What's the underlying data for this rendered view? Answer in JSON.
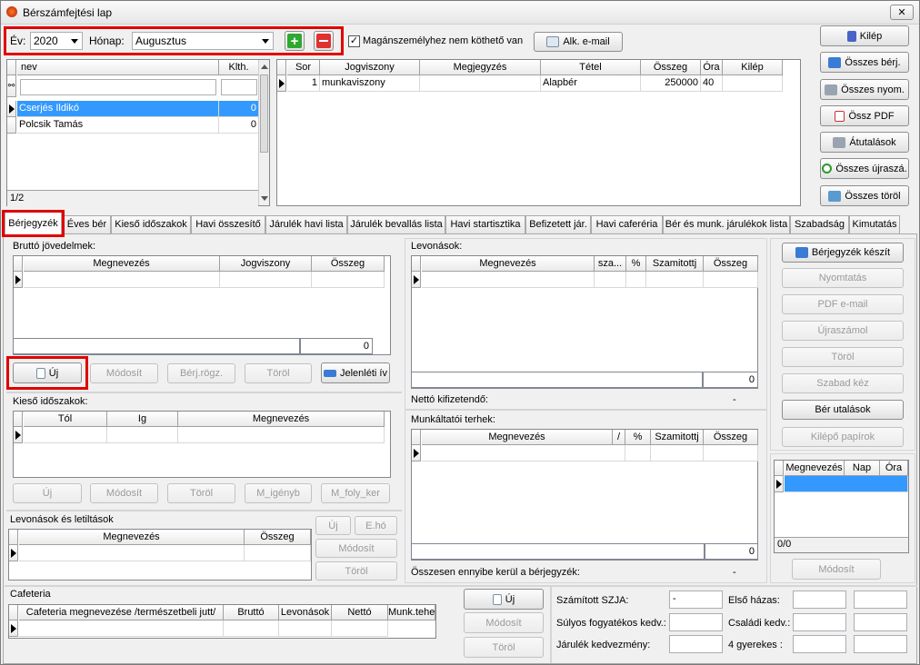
{
  "window": {
    "title": "Bérszámfejtési lap",
    "close": "✕"
  },
  "top": {
    "year_label": "Év:",
    "year_value": "2020",
    "month_label": "Hónap:",
    "month_value": "Augusztus",
    "checkbox_label": "Magánszemélyhez nem köthető van",
    "alk_email": "Alk. e-mail"
  },
  "people": {
    "headers": [
      "nev",
      "Klth."
    ],
    "rows": [
      [
        "Cserjés Ildikó",
        "0"
      ],
      [
        "Polcsik Tamás",
        "0"
      ]
    ],
    "counter": "1/2"
  },
  "jobs": {
    "headers": [
      "Sor",
      "Jogviszony",
      "Megjegyzés",
      "Tétel",
      "Összeg",
      "Óra",
      "Kilép"
    ],
    "rows": [
      [
        "1",
        "munkaviszony",
        "",
        "Alapbér",
        "250000",
        "40",
        ""
      ]
    ]
  },
  "side_buttons": [
    "Kilép",
    "Összes bérj.",
    "Összes nyom.",
    "Össz PDF",
    "Átutalások",
    "Összes újraszá.",
    "Összes töröl"
  ],
  "tabs": [
    "Bérjegyzék",
    "Éves bér",
    "Kieső időszakok",
    "Havi összesítő",
    "Járulék havi lista",
    "Járulék bevallás lista",
    "Havi startisztika",
    "Befizetett jár.",
    "Havi caferéria",
    "Bér és munk. járulékok lista",
    "Szabadság",
    "Kimutatás"
  ],
  "brutto": {
    "title": "Bruttó jövedelmek:",
    "headers": [
      "Megnevezés",
      "Jogviszony",
      "Összeg"
    ],
    "sum": "0",
    "buttons": [
      "Új",
      "Módosít",
      "Bérj.rögz.",
      "Töröl",
      "Jelenléti ív"
    ]
  },
  "kieso": {
    "title": "Kieső időszakok:",
    "headers": [
      "Tól",
      "Ig",
      "Megnevezés"
    ],
    "buttons": [
      "Új",
      "Módosít",
      "Töröl",
      "M_igényb",
      "M_foly_ker"
    ]
  },
  "levonasok_tilt": {
    "title": "Levonások és letiltások",
    "headers": [
      "Megnevezés",
      "Összeg"
    ],
    "buttons": [
      "Új",
      "E.hó",
      "Módosít",
      "Töröl"
    ]
  },
  "cafeteria": {
    "title": "Cafeteria",
    "headers": [
      "Cafeteria megnevezése /természetbeli jutt/",
      "Bruttó",
      "Levonások",
      "Nettó",
      "Munk.teher"
    ],
    "buttons": [
      "Új",
      "Módosít",
      "Töröl"
    ]
  },
  "levonasok": {
    "title": "Levonások:",
    "headers": [
      "Megnevezés",
      "sza...",
      "%",
      "Szamitottj",
      "Összeg"
    ],
    "sum": "0",
    "netto_label": "Nettó kifizetendő:",
    "netto_value": "-"
  },
  "munkaltatoi": {
    "title": "Munkáltatói terhek:",
    "headers": [
      "Megnevezés",
      "/",
      "%",
      "Szamitottj",
      "Összeg"
    ],
    "sum": "0",
    "total_label": "Összesen ennyibe kerül a bérjegyzék:",
    "total_value": "-"
  },
  "right_buttons": [
    "Bérjegyzék készít",
    "Nyomtatás",
    "PDF e-mail",
    "Újraszámol",
    "Töröl",
    "Szabad kéz",
    "Bér utalások",
    "Kilépő papírok"
  ],
  "nap": {
    "headers": [
      "Megnevezés",
      "Nap",
      "Óra"
    ],
    "counter": "0/0",
    "modosit": "Módosít"
  },
  "bottom": {
    "szja_label": "Számított SZJA:",
    "szja_value": "-",
    "sulyos_label": "Súlyos fogyatékos kedv.:",
    "jarulek_label": "Járulék kedvezmény:",
    "elso_label": "Első házas:",
    "csaladi_label": "Családi kedv.:",
    "gyerek_label": "4 gyerekes :"
  }
}
